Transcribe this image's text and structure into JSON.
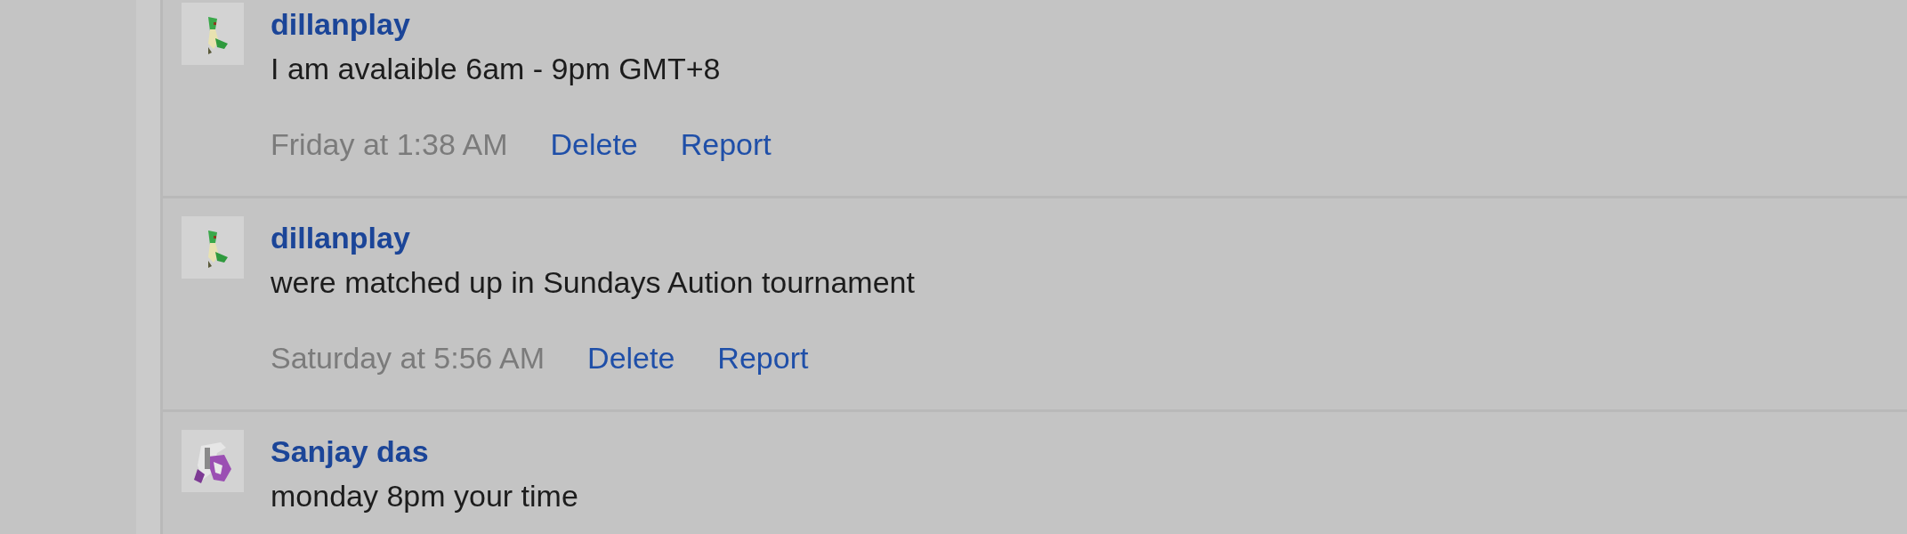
{
  "comments": [
    {
      "author": "dillanplay",
      "message": "I am avalaible 6am - 9pm GMT+8",
      "time": "Friday at 1:38 AM",
      "actions": [
        "Delete",
        "Report"
      ]
    },
    {
      "author": "dillanplay",
      "message": "were matched up in Sundays Aution tournament",
      "time": "Saturday at 5:56 AM",
      "actions": [
        "Delete",
        "Report"
      ]
    },
    {
      "author": "Sanjay das",
      "message": "monday 8pm your time"
    }
  ]
}
